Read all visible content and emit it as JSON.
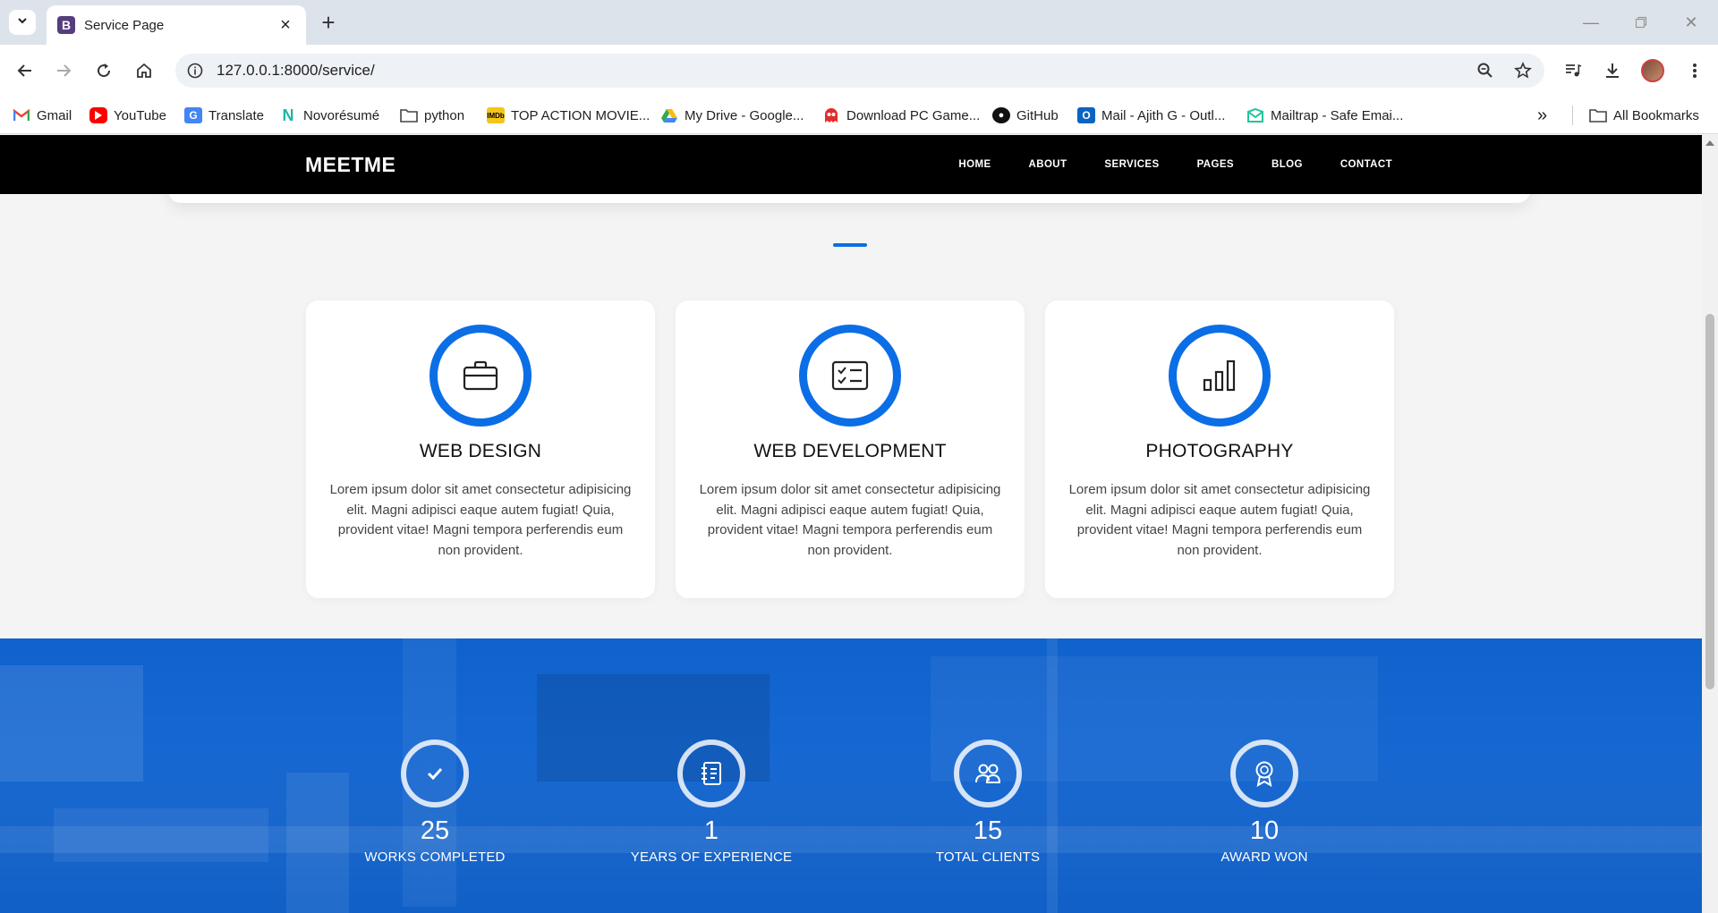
{
  "browser": {
    "tab_title": "Service Page",
    "tab_favicon": "B",
    "url": "127.0.0.1:8000/service/",
    "bookmarks": [
      {
        "label": "Gmail",
        "icon": "gmail-icon"
      },
      {
        "label": "YouTube",
        "icon": "youtube-icon"
      },
      {
        "label": "Translate",
        "icon": "translate-icon"
      },
      {
        "label": "Novorésumé",
        "icon": "novoresume-icon"
      },
      {
        "label": "python",
        "icon": "folder-icon"
      },
      {
        "label": "TOP ACTION MOVIE...",
        "icon": "imdb-icon"
      },
      {
        "label": "My Drive - Google...",
        "icon": "drive-icon"
      },
      {
        "label": "Download PC Game...",
        "icon": "ghost-icon"
      },
      {
        "label": "GitHub",
        "icon": "github-icon"
      },
      {
        "label": "Mail - Ajith G - Outl...",
        "icon": "outlook-icon"
      },
      {
        "label": "Mailtrap - Safe Emai...",
        "icon": "mailtrap-icon"
      }
    ],
    "all_bookmarks": "All Bookmarks"
  },
  "site": {
    "brand": "MEETME",
    "menu": [
      "HOME",
      "ABOUT",
      "SERVICES",
      "PAGES",
      "BLOG",
      "CONTACT"
    ],
    "accent_color": "#0b6ee6"
  },
  "services": [
    {
      "title": "WEB DESIGN",
      "icon": "briefcase-icon",
      "text": "Lorem ipsum dolor sit amet consectetur adipisicing elit. Magni adipisci eaque autem fugiat! Quia, provident vitae! Magni tempora perferendis eum non provident."
    },
    {
      "title": "WEB DEVELOPMENT",
      "icon": "checklist-icon",
      "text": "Lorem ipsum dolor sit amet consectetur adipisicing elit. Magni adipisci eaque autem fugiat! Quia, provident vitae! Magni tempora perferendis eum non provident."
    },
    {
      "title": "PHOTOGRAPHY",
      "icon": "bar-chart-icon",
      "text": "Lorem ipsum dolor sit amet consectetur adipisicing elit. Magni adipisci eaque autem fugiat! Quia, provident vitae! Magni tempora perferendis eum non provident."
    }
  ],
  "stats": [
    {
      "number": "25",
      "label": "WORKS COMPLETED",
      "icon": "check-icon"
    },
    {
      "number": "1",
      "label": "YEARS OF EXPERIENCE",
      "icon": "journal-icon"
    },
    {
      "number": "15",
      "label": "TOTAL CLIENTS",
      "icon": "people-icon"
    },
    {
      "number": "10",
      "label": "AWARD WON",
      "icon": "award-icon"
    }
  ]
}
